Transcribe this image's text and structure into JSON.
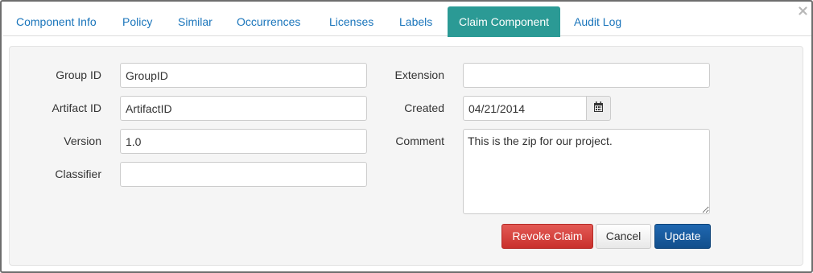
{
  "tabs": [
    {
      "label": "Component Info"
    },
    {
      "label": "Policy"
    },
    {
      "label": "Similar"
    },
    {
      "label": "Occurrences"
    },
    {
      "label": "Licenses"
    },
    {
      "label": "Labels"
    },
    {
      "label": "Claim Component",
      "active": true
    },
    {
      "label": "Audit Log"
    }
  ],
  "close_icon": "close-icon",
  "form": {
    "group_id": {
      "label": "Group ID",
      "value": "GroupID"
    },
    "artifact_id": {
      "label": "Artifact ID",
      "value": "ArtifactID"
    },
    "version": {
      "label": "Version",
      "value": "1.0"
    },
    "classifier": {
      "label": "Classifier",
      "value": ""
    },
    "extension": {
      "label": "Extension",
      "value": ""
    },
    "created": {
      "label": "Created",
      "value": "04/21/2014",
      "icon": "calendar-icon"
    },
    "comment": {
      "label": "Comment",
      "value": "This is the zip for our project."
    }
  },
  "buttons": {
    "revoke": "Revoke Claim",
    "cancel": "Cancel",
    "update": "Update"
  },
  "colors": {
    "active_tab": "#2b9a95",
    "tab_link": "#1a75bb",
    "danger": "#d9534f",
    "primary": "#16589c"
  }
}
